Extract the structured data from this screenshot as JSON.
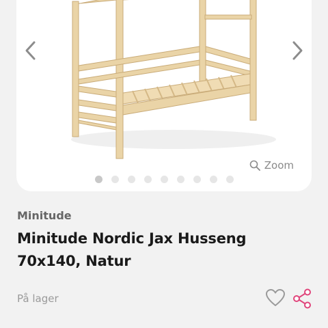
{
  "gallery": {
    "zoom_label": "Zoom",
    "dot_count": 9,
    "active_dot": 0,
    "image": "wooden-house-bed"
  },
  "product": {
    "brand": "Minitude",
    "title": "Minitude Nordic Jax Husseng 70x140, Natur",
    "stock": "På lager"
  },
  "icons": {
    "prev": "chevron-left-icon",
    "next": "chevron-right-icon",
    "zoom": "magnifier-icon",
    "favorite": "heart-icon",
    "share": "share-icon"
  },
  "colors": {
    "background": "#f2f2f2",
    "card": "#ffffff",
    "share_accent": "#e0457b",
    "muted": "#9a9a9a",
    "wood": "#e9d3a6"
  }
}
